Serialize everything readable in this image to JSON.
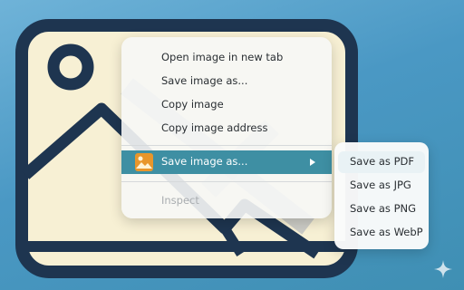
{
  "context_menu": {
    "items": [
      {
        "label": "Open image in new tab"
      },
      {
        "label": "Save image as..."
      },
      {
        "label": "Copy image"
      },
      {
        "label": "Copy image address"
      },
      {
        "label": "Save image as...",
        "icon": "image-icon",
        "highlighted": true,
        "has_submenu": true
      },
      {
        "label": "Inspect",
        "disabled": true
      }
    ]
  },
  "submenu": {
    "items": [
      {
        "label": "Save as PDF"
      },
      {
        "label": "Save as JPG"
      },
      {
        "label": "Save as PNG"
      },
      {
        "label": "Save as WebP"
      }
    ]
  },
  "colors": {
    "background_top": "#6fb3d8",
    "background_bottom": "#3f8fb3",
    "illustration_fill": "#f7f0d4",
    "illustration_stroke": "#1e3550",
    "highlight": "#3e8fa3",
    "icon_orange": "#e8962b"
  },
  "icons": {
    "watermark": "sparkle-icon",
    "submenu_indicator": "chevron-right-icon"
  }
}
